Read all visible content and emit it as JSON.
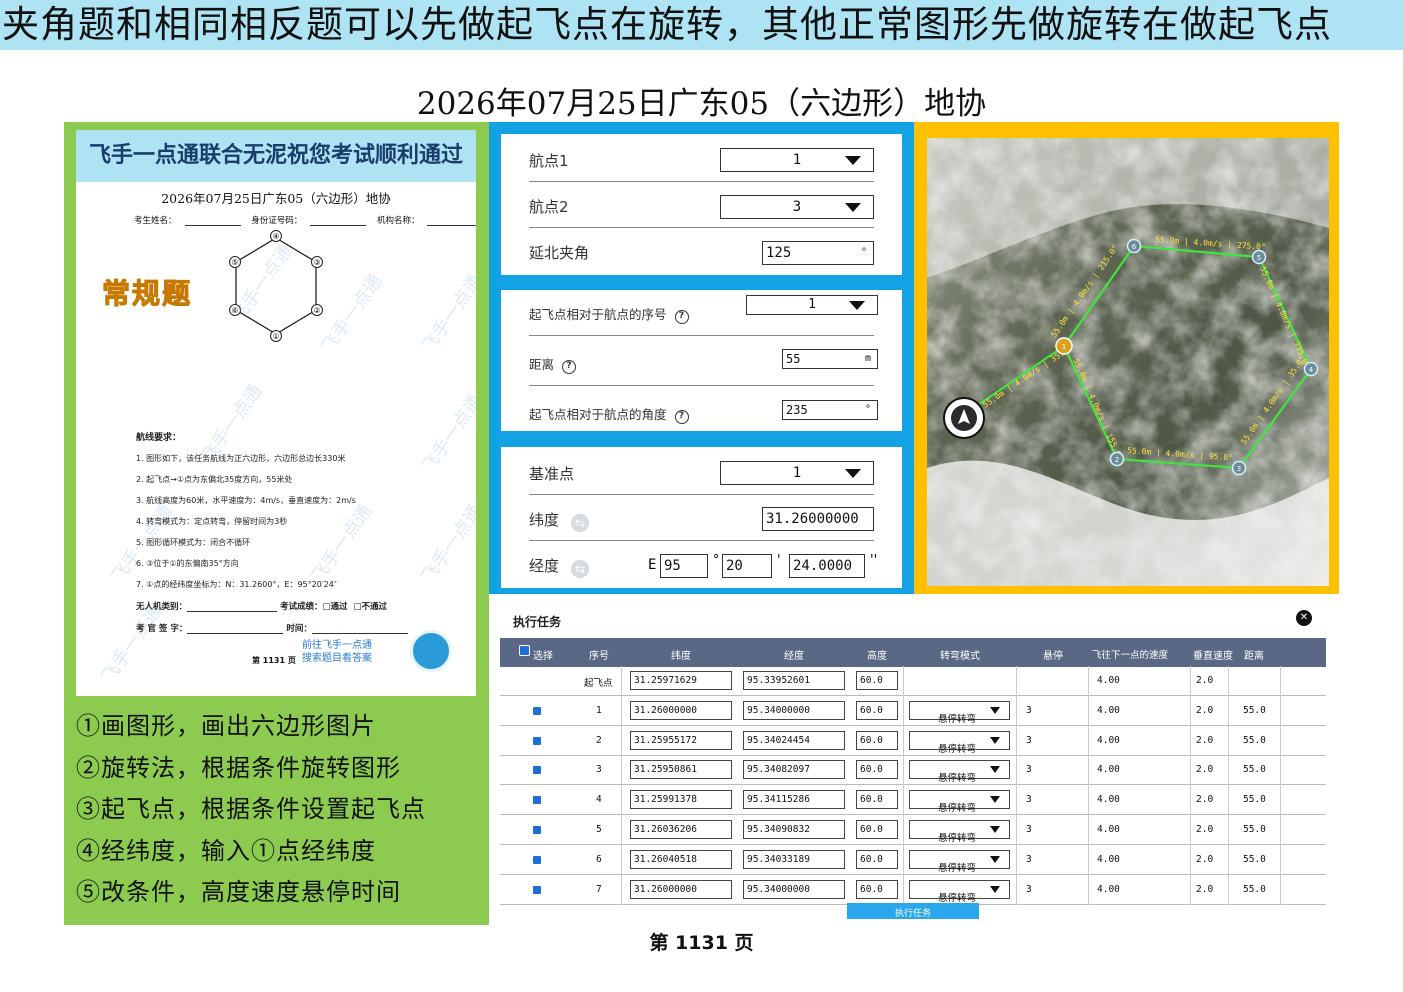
{
  "banner": "夹角题和相同相反题可以先做起飞点在旋转，其他正常图形先做旋转在做起飞点",
  "main_title": "2026年07月25日广东05（六边形）地协",
  "paper": {
    "header": "飞手一点通联合无泥祝您考试顺利通过",
    "title": "2026年07月25日广东05（六边形）地协",
    "field_name": "考生姓名：",
    "field_id": "身份证号码：",
    "field_org": "机构名称：",
    "badge": "常规题",
    "hex_labels": [
      "④",
      "③",
      "②",
      "①",
      "⑥",
      "⑤"
    ],
    "req_title": "航线要求：",
    "requirements": [
      "1.  图形如下，该任务航线为正六边形，六边形总边长330米",
      "2.  起飞点→①点为东偏北35度方向，55米处",
      "3.  航线高度为60米，水平速度为：4m/s，垂直速度为：2m/s",
      "4.  转弯模式为：定点转弯，停留时间为3秒",
      "5.  图形循环模式为：闭合不循环",
      "6.  ③位于①的东偏南35°方向",
      "7.  ①点的经纬度坐标为：N：31.2600°，E：95°20′24″"
    ],
    "uav_type": "无人机类别：",
    "score": "考试成绩：",
    "pass": "□通过",
    "fail": "□不通过",
    "examiner": "考 官 签 字：",
    "time": "时间：",
    "goto_line1": "前往飞手一点通",
    "goto_line2": "搜索题目看答案",
    "page_small": "第 1131 页",
    "watermark": "飞手一点通"
  },
  "steps": [
    "①画图形，画出六边形图片",
    "②旋转法，根据条件旋转图形",
    "③起飞点，根据条件设置起飞点",
    "④经纬度，输入①点经纬度",
    "⑤改条件，高度速度悬停时间"
  ],
  "settings1": {
    "waypoint1_label": "航点1",
    "waypoint1_value": "1",
    "waypoint2_label": "航点2",
    "waypoint2_value": "3",
    "angle_label": "延北夹角",
    "angle_value": "125",
    "angle_unit": "°"
  },
  "settings2": {
    "seq_label": "起飞点相对于航点的序号",
    "seq_value": "1",
    "dist_label": "距离",
    "dist_value": "55",
    "dist_unit": "m",
    "angle_label": "起飞点相对于航点的角度",
    "angle_value": "235",
    "angle_unit": "°",
    "help_icon": "?"
  },
  "settings3": {
    "base_label": "基准点",
    "base_value": "1",
    "lat_label": "纬度",
    "lat_value": "31.26000000",
    "lon_label": "经度",
    "lon_prefix": "E",
    "lon_deg": "95",
    "lon_min": "20",
    "lon_sec": "24.0000",
    "deg_sym": "°",
    "min_sym": "'",
    "sec_sym": "''",
    "swap_icon": "⇆"
  },
  "map": {
    "edge_label": "55.0m | 4.0m/s",
    "headings": [
      "275.0°",
      "335.0°",
      "35.0°",
      "95.0°",
      "155.0°",
      "215.0°"
    ],
    "takeoff_label": "55.0m | 4.0m/s | 35.0°",
    "point_labels": [
      "1",
      "2",
      "3",
      "4",
      "5",
      "6"
    ]
  },
  "task": {
    "title": "执行任务",
    "close_icon": "✕",
    "columns": [
      "选择",
      "序号",
      "纬度",
      "经度",
      "高度",
      "转弯模式",
      "悬停",
      "飞往下一点的速度",
      "垂直速度",
      "距离"
    ],
    "rows": [
      {
        "seq": "起飞点",
        "lat": "31.25971629",
        "lon": "95.33952601",
        "alt": "60.0",
        "mode": "",
        "hover": "",
        "speed": "4.00",
        "vspeed": "2.0",
        "dist": ""
      },
      {
        "seq": "1",
        "lat": "31.26000000",
        "lon": "95.34000000",
        "alt": "60.0",
        "mode": "悬停转弯",
        "hover": "3",
        "speed": "4.00",
        "vspeed": "2.0",
        "dist": "55.0"
      },
      {
        "seq": "2",
        "lat": "31.25955172",
        "lon": "95.34024454",
        "alt": "60.0",
        "mode": "悬停转弯",
        "hover": "3",
        "speed": "4.00",
        "vspeed": "2.0",
        "dist": "55.0"
      },
      {
        "seq": "3",
        "lat": "31.25950861",
        "lon": "95.34082097",
        "alt": "60.0",
        "mode": "悬停转弯",
        "hover": "3",
        "speed": "4.00",
        "vspeed": "2.0",
        "dist": "55.0"
      },
      {
        "seq": "4",
        "lat": "31.25991378",
        "lon": "95.34115286",
        "alt": "60.0",
        "mode": "悬停转弯",
        "hover": "3",
        "speed": "4.00",
        "vspeed": "2.0",
        "dist": "55.0"
      },
      {
        "seq": "5",
        "lat": "31.26036206",
        "lon": "95.34090832",
        "alt": "60.0",
        "mode": "悬停转弯",
        "hover": "3",
        "speed": "4.00",
        "vspeed": "2.0",
        "dist": "55.0"
      },
      {
        "seq": "6",
        "lat": "31.26040518",
        "lon": "95.34033189",
        "alt": "60.0",
        "mode": "悬停转弯",
        "hover": "3",
        "speed": "4.00",
        "vspeed": "2.0",
        "dist": "55.0"
      },
      {
        "seq": "7",
        "lat": "31.26000000",
        "lon": "95.34000000",
        "alt": "60.0",
        "mode": "悬停转弯",
        "hover": "3",
        "speed": "4.00",
        "vspeed": "2.0",
        "dist": "55.0"
      }
    ],
    "exec_button": "执行任务"
  },
  "footer": "第 1131 页",
  "colors": {
    "banner": "#aee3f4",
    "green": "#8dcb50",
    "blue": "#13a3e4",
    "yellow": "#ffc000",
    "path": "#3ee63e",
    "header": "#5a6885"
  }
}
